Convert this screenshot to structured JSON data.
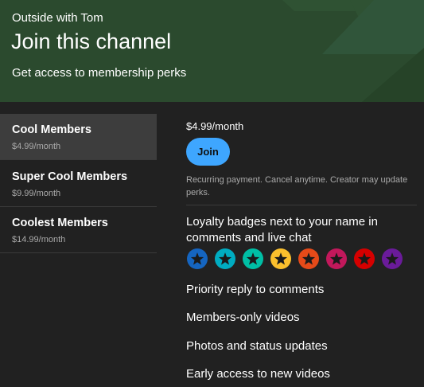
{
  "header": {
    "channel_name": "Outside with Tom",
    "title": "Join this channel",
    "subtitle": "Get access to membership perks"
  },
  "tiers": [
    {
      "name": "Cool Members",
      "price": "$4.99/month"
    },
    {
      "name": "Super Cool Members",
      "price": "$9.99/month"
    },
    {
      "name": "Coolest Members",
      "price": "$14.99/month"
    }
  ],
  "selected_tier": {
    "price": "$4.99/month",
    "join_label": "Join",
    "recurring_note": "Recurring payment. Cancel anytime. Creator may update perks."
  },
  "perks": {
    "loyalty_badges": "Loyalty badges next to your name in comments and live chat",
    "priority_reply": "Priority reply to comments",
    "members_only_videos": "Members-only videos",
    "photos_status": "Photos and status updates",
    "early_access": "Early access to new videos"
  },
  "badge_colors": [
    "#1565c0",
    "#00acc1",
    "#00bfa5",
    "#fbc02d",
    "#e64a19",
    "#c2185b",
    "#d50000",
    "#6a1b9a"
  ],
  "colors": {
    "accent": "#3ea6ff",
    "header_bg": "#2b4a2e",
    "page_bg": "#212121",
    "selected_tier_bg": "#3d3d3d"
  },
  "icons": {
    "badge": "star-badge-icon"
  }
}
